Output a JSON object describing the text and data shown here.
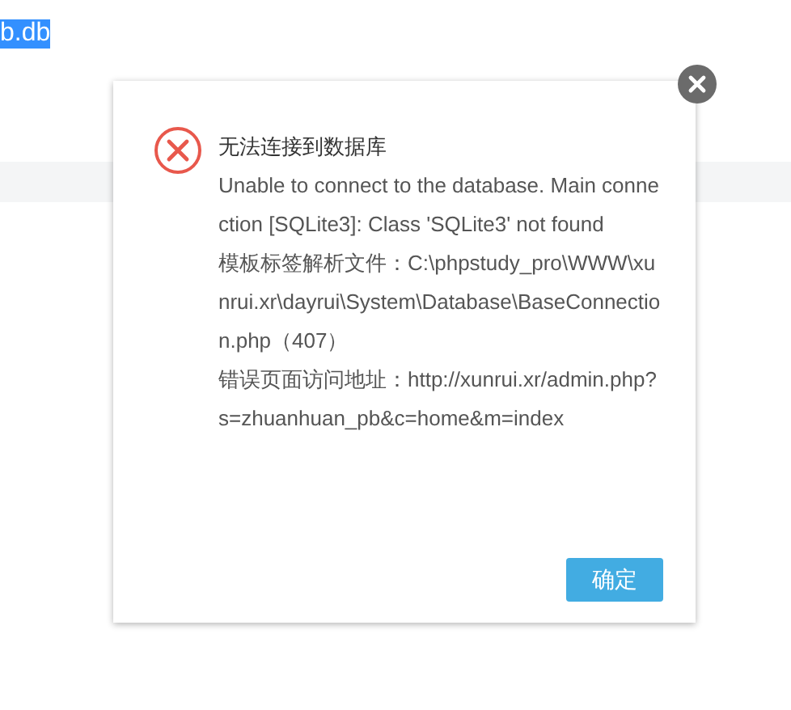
{
  "background": {
    "selected_text": "b.db"
  },
  "dialog": {
    "title": "无法连接到数据库",
    "messages": [
      "Unable to connect to the database. Main connection [SQLite3]: Class 'SQLite3' not found",
      "模板标签解析文件：C:\\phpstudy_pro\\WWW\\xunrui.xr\\dayrui\\System\\Database\\BaseConnection.php（407）",
      "错误页面访问地址：http://xunrui.xr/admin.php?s=zhuanhuan_pb&c=home&m=index"
    ],
    "button": "确定"
  }
}
